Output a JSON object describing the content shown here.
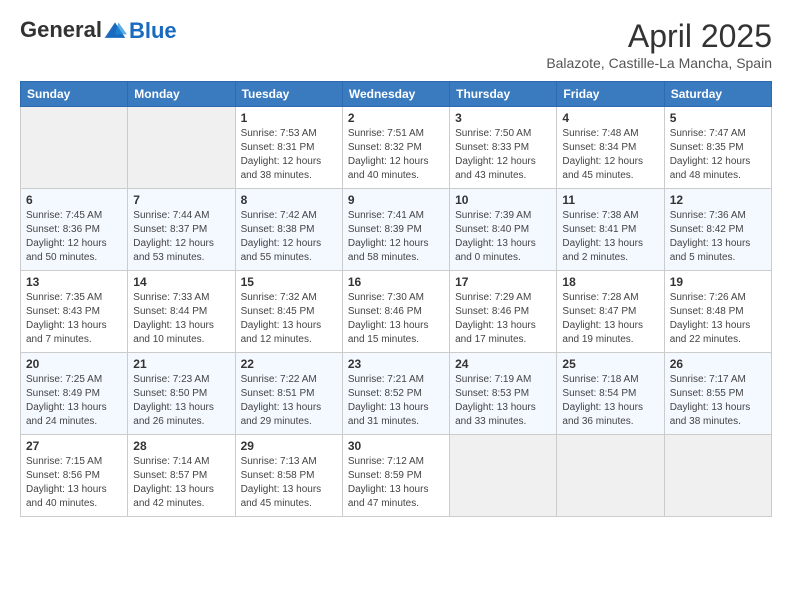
{
  "header": {
    "logo_line1": "General",
    "logo_line2": "Blue",
    "title": "April 2025",
    "subtitle": "Balazote, Castille-La Mancha, Spain"
  },
  "weekdays": [
    "Sunday",
    "Monday",
    "Tuesday",
    "Wednesday",
    "Thursday",
    "Friday",
    "Saturday"
  ],
  "weeks": [
    [
      {
        "day": "",
        "info": ""
      },
      {
        "day": "",
        "info": ""
      },
      {
        "day": "1",
        "info": "Sunrise: 7:53 AM\nSunset: 8:31 PM\nDaylight: 12 hours and 38 minutes."
      },
      {
        "day": "2",
        "info": "Sunrise: 7:51 AM\nSunset: 8:32 PM\nDaylight: 12 hours and 40 minutes."
      },
      {
        "day": "3",
        "info": "Sunrise: 7:50 AM\nSunset: 8:33 PM\nDaylight: 12 hours and 43 minutes."
      },
      {
        "day": "4",
        "info": "Sunrise: 7:48 AM\nSunset: 8:34 PM\nDaylight: 12 hours and 45 minutes."
      },
      {
        "day": "5",
        "info": "Sunrise: 7:47 AM\nSunset: 8:35 PM\nDaylight: 12 hours and 48 minutes."
      }
    ],
    [
      {
        "day": "6",
        "info": "Sunrise: 7:45 AM\nSunset: 8:36 PM\nDaylight: 12 hours and 50 minutes."
      },
      {
        "day": "7",
        "info": "Sunrise: 7:44 AM\nSunset: 8:37 PM\nDaylight: 12 hours and 53 minutes."
      },
      {
        "day": "8",
        "info": "Sunrise: 7:42 AM\nSunset: 8:38 PM\nDaylight: 12 hours and 55 minutes."
      },
      {
        "day": "9",
        "info": "Sunrise: 7:41 AM\nSunset: 8:39 PM\nDaylight: 12 hours and 58 minutes."
      },
      {
        "day": "10",
        "info": "Sunrise: 7:39 AM\nSunset: 8:40 PM\nDaylight: 13 hours and 0 minutes."
      },
      {
        "day": "11",
        "info": "Sunrise: 7:38 AM\nSunset: 8:41 PM\nDaylight: 13 hours and 2 minutes."
      },
      {
        "day": "12",
        "info": "Sunrise: 7:36 AM\nSunset: 8:42 PM\nDaylight: 13 hours and 5 minutes."
      }
    ],
    [
      {
        "day": "13",
        "info": "Sunrise: 7:35 AM\nSunset: 8:43 PM\nDaylight: 13 hours and 7 minutes."
      },
      {
        "day": "14",
        "info": "Sunrise: 7:33 AM\nSunset: 8:44 PM\nDaylight: 13 hours and 10 minutes."
      },
      {
        "day": "15",
        "info": "Sunrise: 7:32 AM\nSunset: 8:45 PM\nDaylight: 13 hours and 12 minutes."
      },
      {
        "day": "16",
        "info": "Sunrise: 7:30 AM\nSunset: 8:46 PM\nDaylight: 13 hours and 15 minutes."
      },
      {
        "day": "17",
        "info": "Sunrise: 7:29 AM\nSunset: 8:46 PM\nDaylight: 13 hours and 17 minutes."
      },
      {
        "day": "18",
        "info": "Sunrise: 7:28 AM\nSunset: 8:47 PM\nDaylight: 13 hours and 19 minutes."
      },
      {
        "day": "19",
        "info": "Sunrise: 7:26 AM\nSunset: 8:48 PM\nDaylight: 13 hours and 22 minutes."
      }
    ],
    [
      {
        "day": "20",
        "info": "Sunrise: 7:25 AM\nSunset: 8:49 PM\nDaylight: 13 hours and 24 minutes."
      },
      {
        "day": "21",
        "info": "Sunrise: 7:23 AM\nSunset: 8:50 PM\nDaylight: 13 hours and 26 minutes."
      },
      {
        "day": "22",
        "info": "Sunrise: 7:22 AM\nSunset: 8:51 PM\nDaylight: 13 hours and 29 minutes."
      },
      {
        "day": "23",
        "info": "Sunrise: 7:21 AM\nSunset: 8:52 PM\nDaylight: 13 hours and 31 minutes."
      },
      {
        "day": "24",
        "info": "Sunrise: 7:19 AM\nSunset: 8:53 PM\nDaylight: 13 hours and 33 minutes."
      },
      {
        "day": "25",
        "info": "Sunrise: 7:18 AM\nSunset: 8:54 PM\nDaylight: 13 hours and 36 minutes."
      },
      {
        "day": "26",
        "info": "Sunrise: 7:17 AM\nSunset: 8:55 PM\nDaylight: 13 hours and 38 minutes."
      }
    ],
    [
      {
        "day": "27",
        "info": "Sunrise: 7:15 AM\nSunset: 8:56 PM\nDaylight: 13 hours and 40 minutes."
      },
      {
        "day": "28",
        "info": "Sunrise: 7:14 AM\nSunset: 8:57 PM\nDaylight: 13 hours and 42 minutes."
      },
      {
        "day": "29",
        "info": "Sunrise: 7:13 AM\nSunset: 8:58 PM\nDaylight: 13 hours and 45 minutes."
      },
      {
        "day": "30",
        "info": "Sunrise: 7:12 AM\nSunset: 8:59 PM\nDaylight: 13 hours and 47 minutes."
      },
      {
        "day": "",
        "info": ""
      },
      {
        "day": "",
        "info": ""
      },
      {
        "day": "",
        "info": ""
      }
    ]
  ]
}
